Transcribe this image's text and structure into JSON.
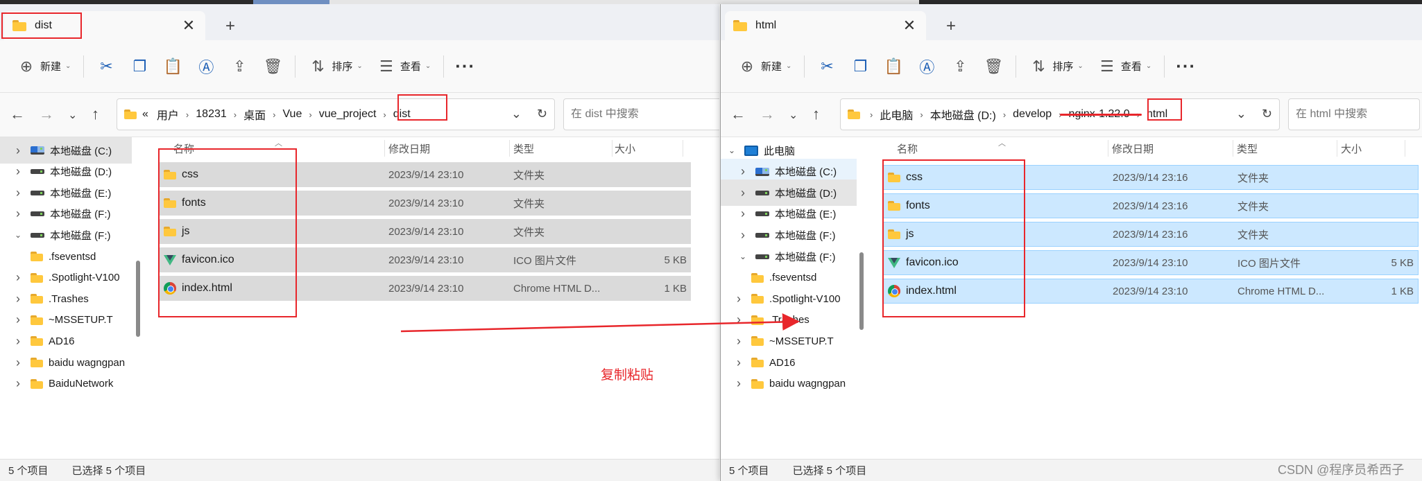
{
  "colors": {
    "accent": "#1d5fb5",
    "annotation_red": "#e8262b",
    "selected_gray": "#dadada",
    "selected_blue": "#cce8ff"
  },
  "left": {
    "tab_title": "dist",
    "toolbar": {
      "new_label": "新建",
      "sort_label": "排序",
      "view_label": "查看",
      "more": "···",
      "icons": [
        "cut-icon",
        "copy-icon",
        "paste-icon",
        "rename-icon",
        "share-icon",
        "delete-icon"
      ]
    },
    "breadcrumb": {
      "overflow": "«",
      "items": [
        "用户",
        "18231",
        "桌面",
        "Vue",
        "vue_project",
        "dist"
      ]
    },
    "search_placeholder": "在 dist 中搜索",
    "sidebar": [
      {
        "label": "本地磁盘 (C:)",
        "type": "drive-sys",
        "expand": "collapsed"
      },
      {
        "label": "本地磁盘 (D:)",
        "type": "drive",
        "expand": "collapsed"
      },
      {
        "label": "本地磁盘 (E:)",
        "type": "drive",
        "expand": "collapsed"
      },
      {
        "label": "本地磁盘 (F:)",
        "type": "drive",
        "expand": "collapsed"
      },
      {
        "label": "本地磁盘 (F:)",
        "type": "drive",
        "expand": "expanded"
      },
      {
        "label": ".fseventsd",
        "type": "folder",
        "expand": "none"
      },
      {
        "label": ".Spotlight-V100",
        "type": "folder",
        "expand": "collapsed"
      },
      {
        "label": ".Trashes",
        "type": "folder",
        "expand": "collapsed"
      },
      {
        "label": "~MSSETUP.T",
        "type": "folder",
        "expand": "collapsed"
      },
      {
        "label": "AD16",
        "type": "folder",
        "expand": "collapsed"
      },
      {
        "label": "baidu wagngpan",
        "type": "folder",
        "expand": "collapsed"
      },
      {
        "label": "BaiduNetwork",
        "type": "folder",
        "expand": "collapsed"
      }
    ],
    "columns": {
      "name": "名称",
      "date": "修改日期",
      "type": "类型",
      "size": "大小"
    },
    "files": [
      {
        "name": "css",
        "date": "2023/9/14 23:10",
        "type": "文件夹",
        "size": "",
        "icon": "folder-icon"
      },
      {
        "name": "fonts",
        "date": "2023/9/14 23:10",
        "type": "文件夹",
        "size": "",
        "icon": "folder-icon"
      },
      {
        "name": "js",
        "date": "2023/9/14 23:10",
        "type": "文件夹",
        "size": "",
        "icon": "folder-icon"
      },
      {
        "name": "favicon.ico",
        "date": "2023/9/14 23:10",
        "type": "ICO 图片文件",
        "size": "5 KB",
        "icon": "vue-logo-icon"
      },
      {
        "name": "index.html",
        "date": "2023/9/14 23:10",
        "type": "Chrome HTML D...",
        "size": "1 KB",
        "icon": "chrome-icon"
      }
    ],
    "status": {
      "count": "5 个项目",
      "selected": "已选择 5 个项目"
    }
  },
  "right": {
    "tab_title": "html",
    "toolbar": {
      "new_label": "新建",
      "sort_label": "排序",
      "view_label": "查看",
      "more": "···",
      "icons": [
        "cut-icon",
        "copy-icon",
        "paste-icon",
        "rename-icon",
        "share-icon",
        "delete-icon"
      ]
    },
    "breadcrumb": {
      "items": [
        "此电脑",
        "本地磁盘 (D:)",
        "develop",
        "nginx-1.22.0",
        "html"
      ]
    },
    "search_placeholder": "在 html 中搜索",
    "sidebar": [
      {
        "label": "此电脑",
        "type": "pc",
        "expand": "expanded"
      },
      {
        "label": "本地磁盘 (C:)",
        "type": "drive-sys",
        "expand": "collapsed"
      },
      {
        "label": "本地磁盘 (D:)",
        "type": "drive",
        "expand": "collapsed"
      },
      {
        "label": "本地磁盘 (E:)",
        "type": "drive",
        "expand": "collapsed"
      },
      {
        "label": "本地磁盘 (F:)",
        "type": "drive",
        "expand": "collapsed"
      },
      {
        "label": "本地磁盘 (F:)",
        "type": "drive",
        "expand": "expanded"
      },
      {
        "label": ".fseventsd",
        "type": "folder",
        "expand": "none"
      },
      {
        "label": ".Spotlight-V100",
        "type": "folder",
        "expand": "collapsed"
      },
      {
        "label": ".Trashes",
        "type": "folder",
        "expand": "collapsed"
      },
      {
        "label": "~MSSETUP.T",
        "type": "folder",
        "expand": "collapsed"
      },
      {
        "label": "AD16",
        "type": "folder",
        "expand": "collapsed"
      },
      {
        "label": "baidu wagngpan",
        "type": "folder",
        "expand": "collapsed"
      }
    ],
    "columns": {
      "name": "名称",
      "date": "修改日期",
      "type": "类型",
      "size": "大小"
    },
    "files": [
      {
        "name": "css",
        "date": "2023/9/14 23:16",
        "type": "文件夹",
        "size": "",
        "icon": "folder-icon"
      },
      {
        "name": "fonts",
        "date": "2023/9/14 23:16",
        "type": "文件夹",
        "size": "",
        "icon": "folder-icon"
      },
      {
        "name": "js",
        "date": "2023/9/14 23:16",
        "type": "文件夹",
        "size": "",
        "icon": "folder-icon"
      },
      {
        "name": "favicon.ico",
        "date": "2023/9/14 23:10",
        "type": "ICO 图片文件",
        "size": "5 KB",
        "icon": "vue-logo-icon"
      },
      {
        "name": "index.html",
        "date": "2023/9/14 23:10",
        "type": "Chrome HTML D...",
        "size": "1 KB",
        "icon": "chrome-icon"
      }
    ],
    "status": {
      "count": "5 个项目",
      "selected": "已选择 5 个项目"
    }
  },
  "annotation": "复制粘贴",
  "watermark": "CSDN @程序员希西子"
}
